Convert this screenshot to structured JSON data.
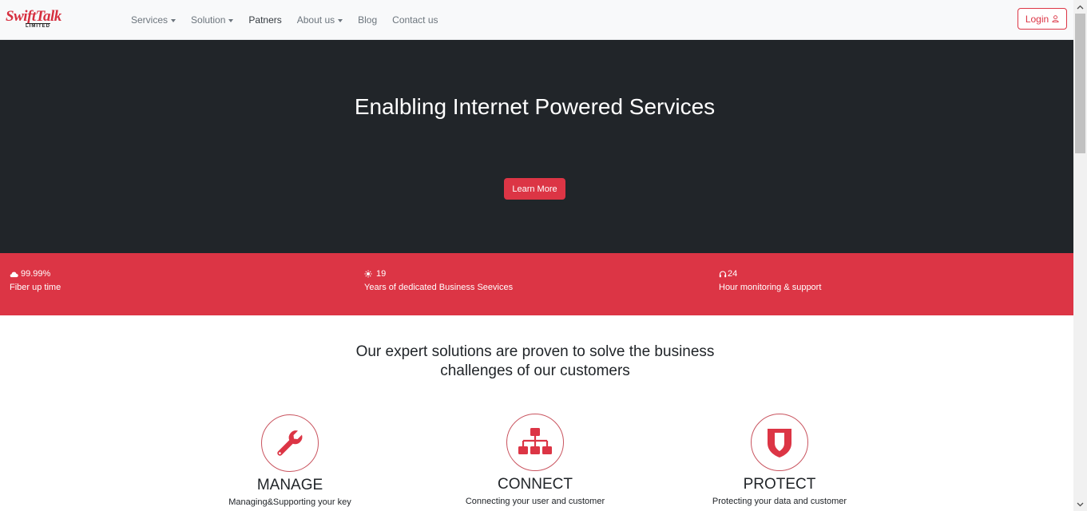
{
  "brand": {
    "name": "SwiftTalk",
    "sub": "LIMITED"
  },
  "nav": {
    "items": [
      {
        "label": "Services",
        "dropdown": true
      },
      {
        "label": "Solution",
        "dropdown": true
      },
      {
        "label": "Patners",
        "dropdown": false,
        "active": true
      },
      {
        "label": "About us",
        "dropdown": true
      },
      {
        "label": "Blog",
        "dropdown": false
      },
      {
        "label": "Contact us",
        "dropdown": false
      }
    ],
    "login_label": "Login",
    "login_icon": "user-icon"
  },
  "hero": {
    "title": "Enalbling Internet Powered Services",
    "cta_label": "Learn More"
  },
  "stats": [
    {
      "icon": "cloud-icon",
      "value": "99.99%",
      "label": "Fiber up time"
    },
    {
      "icon": "sun-icon",
      "value": "19",
      "label": "Years of dedicated Business Seevices"
    },
    {
      "icon": "headphones-icon",
      "value": "24",
      "label": "Hour monitoring & support"
    }
  ],
  "solutions": {
    "title_line1": "Our expert solutions are proven to solve the business",
    "title_line2": "challenges of our customers",
    "cards": [
      {
        "icon": "wrench-icon",
        "title": "MANAGE",
        "text": "Managing&Supporting your key"
      },
      {
        "icon": "network-icon",
        "title": "CONNECT",
        "text": "Connecting your user and customer"
      },
      {
        "icon": "shield-icon",
        "title": "PROTECT",
        "text": "Protecting your data and customer"
      }
    ]
  },
  "colors": {
    "accent": "#dc3545",
    "hero_bg": "#212529",
    "navbar_bg": "#f8f9fa",
    "text_dark": "#212529",
    "nav_text": "#6c757d"
  }
}
